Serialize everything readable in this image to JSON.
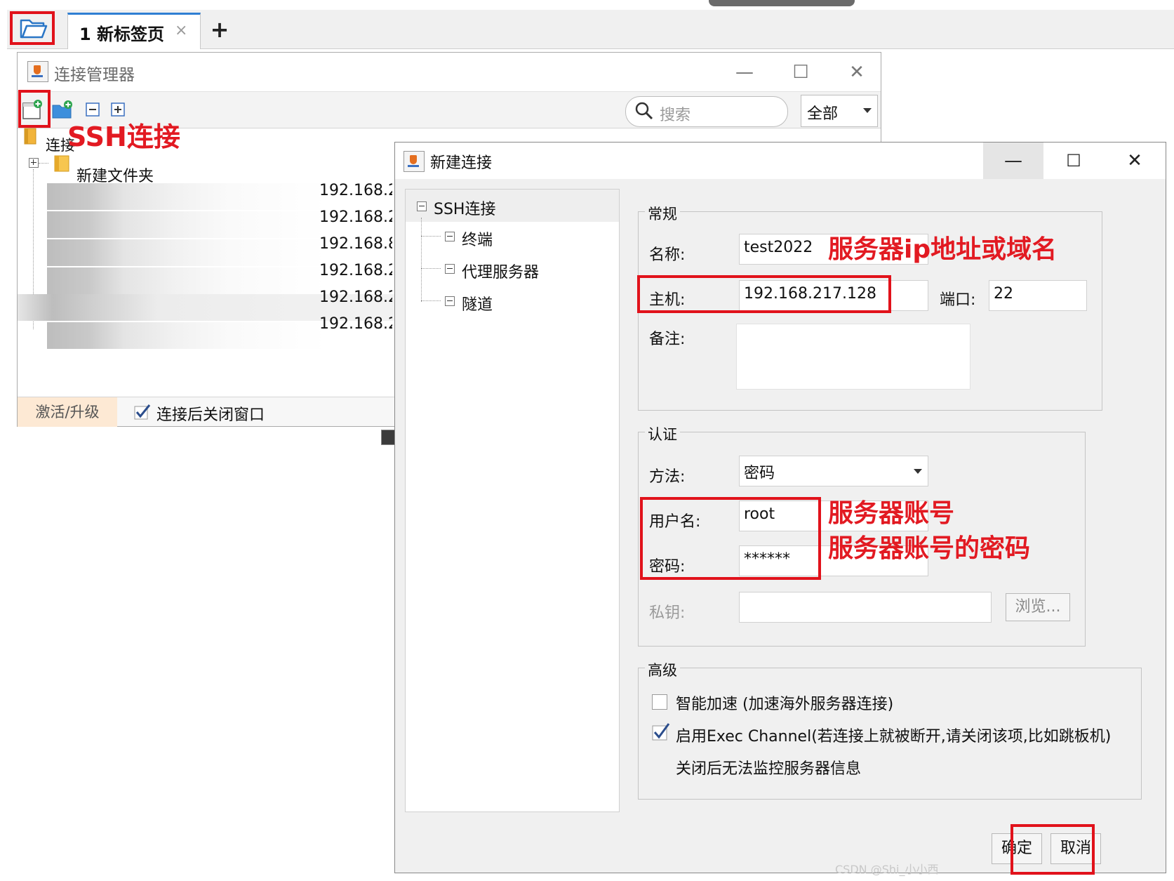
{
  "tabs": {
    "tab1_label": "1 新标签页",
    "tab1_close": "×",
    "new_tab": "+"
  },
  "manager": {
    "title": "连接管理器",
    "window_minimize": "—",
    "window_maximize": "☐",
    "window_close": "✕",
    "search_placeholder": "搜索",
    "filter_value": "全部",
    "tree_root": "连接",
    "tree_folder": "新建文件夹",
    "ips": [
      "192.168.2",
      "192.168.2",
      "192.168.8",
      "192.168.2",
      "192.168.2",
      "192.168.2"
    ],
    "activate_label": "激活/升级",
    "close_after_label": "连接后关闭窗口",
    "close_after_checked": true
  },
  "dialog": {
    "title": "新建连接",
    "minimize": "—",
    "maximize": "☐",
    "close": "✕",
    "tree": {
      "root": "SSH连接",
      "children": [
        "终端",
        "代理服务器",
        "隧道"
      ]
    },
    "general": {
      "group_label": "常规",
      "name_label": "名称:",
      "name_value": "test2022",
      "host_label": "主机:",
      "host_value": "192.168.217.128",
      "port_label": "端口:",
      "port_value": "22",
      "note_label": "备注:",
      "note_value": ""
    },
    "auth": {
      "group_label": "认证",
      "method_label": "方法:",
      "method_value": "密码",
      "user_label": "用户名:",
      "user_value": "root",
      "password_label": "密码:",
      "password_value": "******",
      "key_label": "私钥:",
      "key_value": "",
      "browse_label": "浏览..."
    },
    "advanced": {
      "group_label": "高级",
      "smart_accel_label": "智能加速 (加速海外服务器连接)",
      "smart_accel_checked": false,
      "exec_channel_label": "启用Exec Channel(若连接上就被断开,请关闭该项,比如跳板机)",
      "exec_channel_checked": true,
      "exec_channel_note": "关闭后无法监控服务器信息"
    },
    "ok_label": "确定",
    "cancel_label": "取消"
  },
  "annotations": {
    "ssh_connect": "SSH连接",
    "server_host": "服务器ip地址或域名",
    "server_account": "服务器账号",
    "server_password": "服务器账号的密码",
    "highlight_color": "#e1121b"
  },
  "watermark": "CSDN @Shi_小小西"
}
